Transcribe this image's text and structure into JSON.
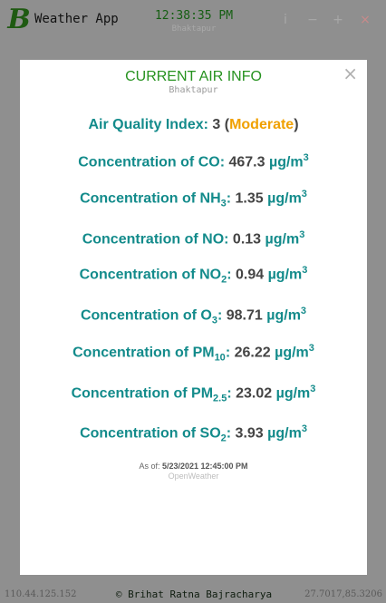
{
  "app": {
    "logo_letter": "B",
    "title": "Weather App",
    "time": "12:38:35 PM",
    "location": "Bhaktapur",
    "window_buttons": {
      "info": "i",
      "minimize": "−",
      "maximize": "+",
      "close": "×"
    }
  },
  "modal": {
    "close_symbol": "×",
    "title": "CURRENT AIR INFO",
    "subtitle": "Bhaktapur",
    "aqi": {
      "label": "Air Quality Index:",
      "value": "3",
      "category": "Moderate"
    },
    "prefix": "Concentration of",
    "unit_base": "µg/m",
    "unit_exp": "3",
    "pollutants": [
      {
        "base": "CO",
        "sub": "",
        "value": "467.3"
      },
      {
        "base": "NH",
        "sub": "3",
        "value": "1.35"
      },
      {
        "base": "NO",
        "sub": "",
        "value": "0.13"
      },
      {
        "base": "NO",
        "sub": "2",
        "value": "0.94"
      },
      {
        "base": "O",
        "sub": "3",
        "value": "98.71"
      },
      {
        "base": "PM",
        "sub": "10",
        "value": "26.22"
      },
      {
        "base": "PM",
        "sub": "2.5",
        "value": "23.02"
      },
      {
        "base": "SO",
        "sub": "2",
        "value": "3.93"
      }
    ],
    "as_of_label": "As of:",
    "as_of_value": "5/23/2021 12:45:00 PM",
    "source": "OpenWeather"
  },
  "footer": {
    "ip": "110.44.125.152",
    "credit": "© Brihat Ratna Bajracharya",
    "coords": "27.7017,85.3206"
  },
  "colors": {
    "brand_green": "#26921f",
    "teal_label": "#138b8b",
    "aqi_moderate": "#f0a000",
    "backdrop": "#8f8f8f"
  }
}
